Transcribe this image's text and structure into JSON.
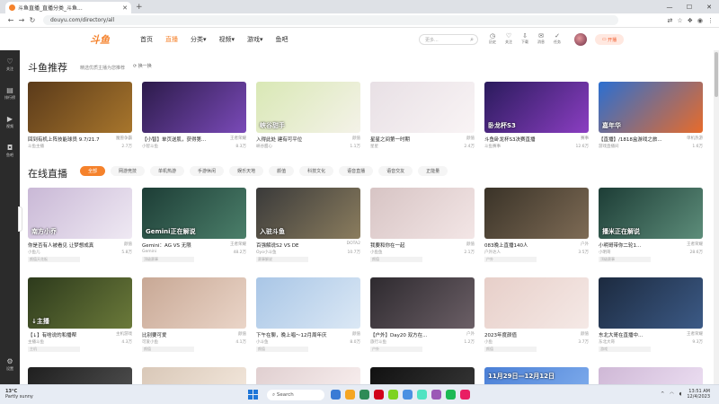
{
  "browser": {
    "tab_title": "斗鱼直播_直播分类_斗鱼...",
    "url": "douyu.com/directory/all"
  },
  "sidebar": {
    "items": [
      {
        "icon": "heart-icon",
        "glyph": "♡",
        "label": "关注"
      },
      {
        "icon": "doc-icon",
        "glyph": "▤",
        "label": "排行榜"
      },
      {
        "icon": "play-icon",
        "glyph": "▶",
        "label": "视频"
      },
      {
        "icon": "chat-icon",
        "glyph": "◘",
        "label": "鱼吧"
      }
    ],
    "bottom": {
      "icon": "settings-icon",
      "glyph": "⚙",
      "label": "设置"
    }
  },
  "header": {
    "logo": "斗鱼",
    "nav": [
      "首页",
      "直播",
      "分类▾",
      "视频▾",
      "游戏▾",
      "鱼吧"
    ],
    "active_nav": 1,
    "search_placeholder": "更多...",
    "icons": [
      {
        "name": "history-icon",
        "glyph": "◷",
        "label": "历史"
      },
      {
        "name": "follow-icon",
        "glyph": "♡",
        "label": "关注"
      },
      {
        "name": "download-icon",
        "glyph": "⇩",
        "label": "下载"
      },
      {
        "name": "message-icon",
        "glyph": "✉",
        "label": "消息"
      },
      {
        "name": "task-icon",
        "glyph": "✓",
        "label": "任务"
      }
    ],
    "live_button": "开播"
  },
  "recommend": {
    "title": "斗鱼推荐",
    "subtitle": "精选优质主播为您推荐",
    "swap": "换一换",
    "cards": [
      {
        "name": "回到有机上阵技能球员 9.7/21.7",
        "cat": "魔兽争霸",
        "anchor": "斗鱼主播",
        "hot": "2.7万",
        "tag": "",
        "colors": [
          "#5a3a1a",
          "#a8762c"
        ],
        "overlay": ""
      },
      {
        "name": "【小智】单页送肌，获得第...",
        "cat": "王者荣耀",
        "anchor": "小智斗鱼",
        "hot": "8.3万",
        "tag": "",
        "colors": [
          "#2c1b4a",
          "#7a4ab8"
        ],
        "overlay": ""
      },
      {
        "name": "入得此处 建有可平位",
        "cat": "颜值",
        "anchor": "峡谷甜心",
        "hot": "1.1万",
        "tag": "",
        "colors": [
          "#d9e8b5",
          "#f4f2e8"
        ],
        "overlay": "峡谷甜手"
      },
      {
        "name": "星星之间第一时期",
        "cat": "颜值",
        "anchor": "星星",
        "hot": "2.4万",
        "tag": "",
        "colors": [
          "#e8e0e5",
          "#f9f4f5"
        ],
        "overlay": ""
      },
      {
        "name": "斗鱼卧龙杯S3决赛直播",
        "cat": "赛事",
        "anchor": "斗鱼赛事",
        "hot": "12.6万",
        "tag": "",
        "colors": [
          "#2a1b5c",
          "#8b3ec2"
        ],
        "overlay": "卧龙杯S3"
      },
      {
        "name": "【直播】/1818盒游戏之旅...",
        "cat": "单机热游",
        "anchor": "游戏直播间",
        "hot": "1.6万",
        "tag": "",
        "colors": [
          "#2b6fd1",
          "#e86b2a"
        ],
        "overlay": "嘉年华"
      }
    ]
  },
  "live": {
    "title": "在线直播",
    "filters": [
      "全部",
      "网游竞技",
      "单机热游",
      "手游休闲",
      "娱乐天地",
      "颜值",
      "科技文化",
      "语音直播",
      "语音交友",
      "正能量"
    ],
    "active_filter": 0,
    "rows": [
      [
        {
          "name": "你是否有人被看见 让梦想成真",
          "cat": "颜值",
          "anchor": "小鱼儿",
          "hot": "5.8万",
          "tag": "颜值天花板",
          "colors": [
            "#c9b8d6",
            "#efe9f3"
          ],
          "overlay": "南方小乔"
        },
        {
          "name": "Gemini：AG VS 无限",
          "cat": "王者荣耀",
          "anchor": "Gemini",
          "hot": "48.2万",
          "tag": "顶级赛事",
          "colors": [
            "#1d3d36",
            "#4b7f6a"
          ],
          "overlay": "Gemini正在解说"
        },
        {
          "name": "百强解说S2 VS DE",
          "cat": "DOTA2",
          "anchor": "Oyo小斗鱼",
          "hot": "10.7万",
          "tag": "赛事解说",
          "colors": [
            "#3a3a3a",
            "#8b7d5e"
          ],
          "overlay": "入驻斗鱼"
        },
        {
          "name": "我要和你在一起",
          "cat": "颜值",
          "anchor": "小鱼鱼",
          "hot": "2.1万",
          "tag": "颜值",
          "colors": [
            "#d7c4c4",
            "#f3e6e6"
          ],
          "overlay": ""
        },
        {
          "name": "083晚上直播140人",
          "cat": "户外",
          "anchor": "户外达人",
          "hot": "3.5万",
          "tag": "户外",
          "colors": [
            "#3a3328",
            "#7e6b55"
          ],
          "overlay": ""
        },
        {
          "name": "小明哥带你二轮1...",
          "cat": "王者荣耀",
          "anchor": "小明哥",
          "hot": "28.6万",
          "tag": "顶级赛事",
          "colors": [
            "#1d3d36",
            "#5d8d7a"
          ],
          "overlay": "播米正在解说"
        }
      ],
      [
        {
          "name": "【↓】有啥说的和播帮",
          "cat": "主机游戏",
          "anchor": "主播斗鱼",
          "hot": "4.3万",
          "tag": "主机",
          "colors": [
            "#2d3a1c",
            "#6b7a3a"
          ],
          "overlay": "↓主播"
        },
        {
          "name": "比别要可爱",
          "cat": "颜值",
          "anchor": "可爱小鱼",
          "hot": "4.1万",
          "tag": "颜值",
          "colors": [
            "#c8a895",
            "#ead5c8"
          ],
          "overlay": ""
        },
        {
          "name": "下午在聊，晚上唱～12月周年庆",
          "cat": "颜值",
          "anchor": "小斗鱼",
          "hot": "8.0万",
          "tag": "颜值",
          "colors": [
            "#a9c6e6",
            "#dbe8f5"
          ],
          "overlay": ""
        },
        {
          "name": "【户外】Day20 双方在...",
          "cat": "户外",
          "anchor": "旅行斗鱼",
          "hot": "1.2万",
          "tag": "户外",
          "colors": [
            "#2e2a2f",
            "#6b5f66"
          ],
          "overlay": ""
        },
        {
          "name": "2023年度颜值",
          "cat": "颜值",
          "anchor": "小鱼",
          "hot": "3.7万",
          "tag": "颜值",
          "colors": [
            "#e7cfc9",
            "#f5e9e6"
          ],
          "overlay": ""
        },
        {
          "name": "东北大哥在直播中...",
          "cat": "王者荣耀",
          "anchor": "东北大哥",
          "hot": "9.3万",
          "tag": "游戏",
          "colors": [
            "#1c2a3f",
            "#3c5a86"
          ],
          "overlay": ""
        }
      ]
    ],
    "partial_row": [
      {
        "colors": [
          "#1f1f1f",
          "#4a4a4a"
        ]
      },
      {
        "colors": [
          "#d9c8b8",
          "#f0e4d8"
        ]
      },
      {
        "colors": [
          "#e0cfd0",
          "#f6ecec"
        ]
      },
      {
        "colors": [
          "#111111",
          "#333333"
        ]
      },
      {
        "colors": [
          "#4a7fd6",
          "#7aa8ea"
        ],
        "overlay": "11月29日—12月12日"
      },
      {
        "colors": [
          "#cfb8d6",
          "#eadcf0"
        ]
      }
    ]
  },
  "taskbar": {
    "weather_temp": "13°C",
    "weather_desc": "Partly sunny",
    "search": "Search",
    "time": "13:51 AM",
    "date": "12/4/2023",
    "app_colors": [
      "#3a7bd5",
      "#f5a623",
      "#2e8b57",
      "#d0021b",
      "#7ed321",
      "#4a90e2",
      "#50e3c2",
      "#9b59b6",
      "#1db954",
      "#e91e63"
    ]
  }
}
